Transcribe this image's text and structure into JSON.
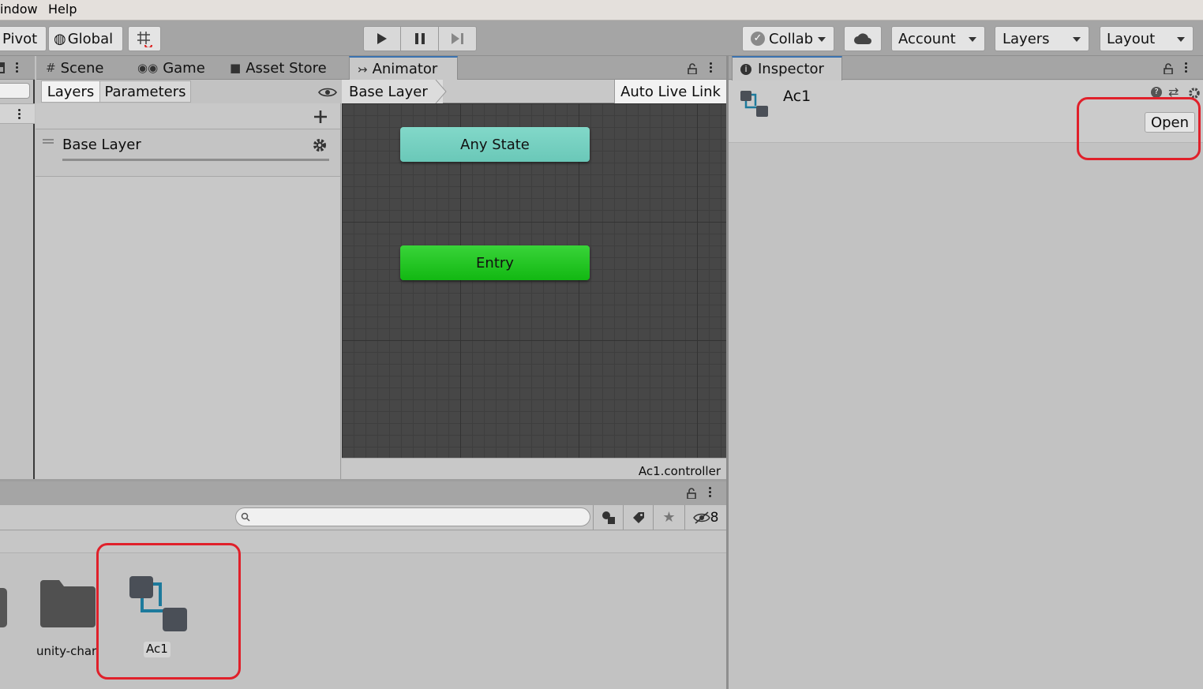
{
  "menubar": {
    "items": [
      "indow",
      "Help"
    ]
  },
  "toolbar": {
    "pivot_label": "Pivot",
    "global_label": "Global",
    "collab_label": "Collab",
    "account_label": "Account",
    "layers_label": "Layers",
    "layout_label": "Layout"
  },
  "center_tabs": {
    "scene": "Scene",
    "game": "Game",
    "asset_store": "Asset Store",
    "animator": "Animator"
  },
  "animator": {
    "left_tabs": {
      "layers": "Layers",
      "parameters": "Parameters"
    },
    "layer_name": "Base Layer",
    "breadcrumb": "Base Layer",
    "auto_live_link": "Auto Live Link",
    "states": {
      "any_state": "Any State",
      "entry": "Entry"
    },
    "footer_file": "Ac1.controller",
    "colors": {
      "any_state": "#6fcfbe",
      "entry": "#1fc21f",
      "graph_bg": "#474747"
    }
  },
  "inspector": {
    "tab_label": "Inspector",
    "asset_name": "Ac1",
    "open_button": "Open"
  },
  "project": {
    "search_placeholder": "",
    "hidden_count": "8",
    "items": [
      {
        "name": "unity-char",
        "icon": "folder-icon"
      },
      {
        "name": "Ac1",
        "icon": "animator-controller-icon",
        "selected": true
      }
    ]
  },
  "highlight_color": "#e0202a"
}
